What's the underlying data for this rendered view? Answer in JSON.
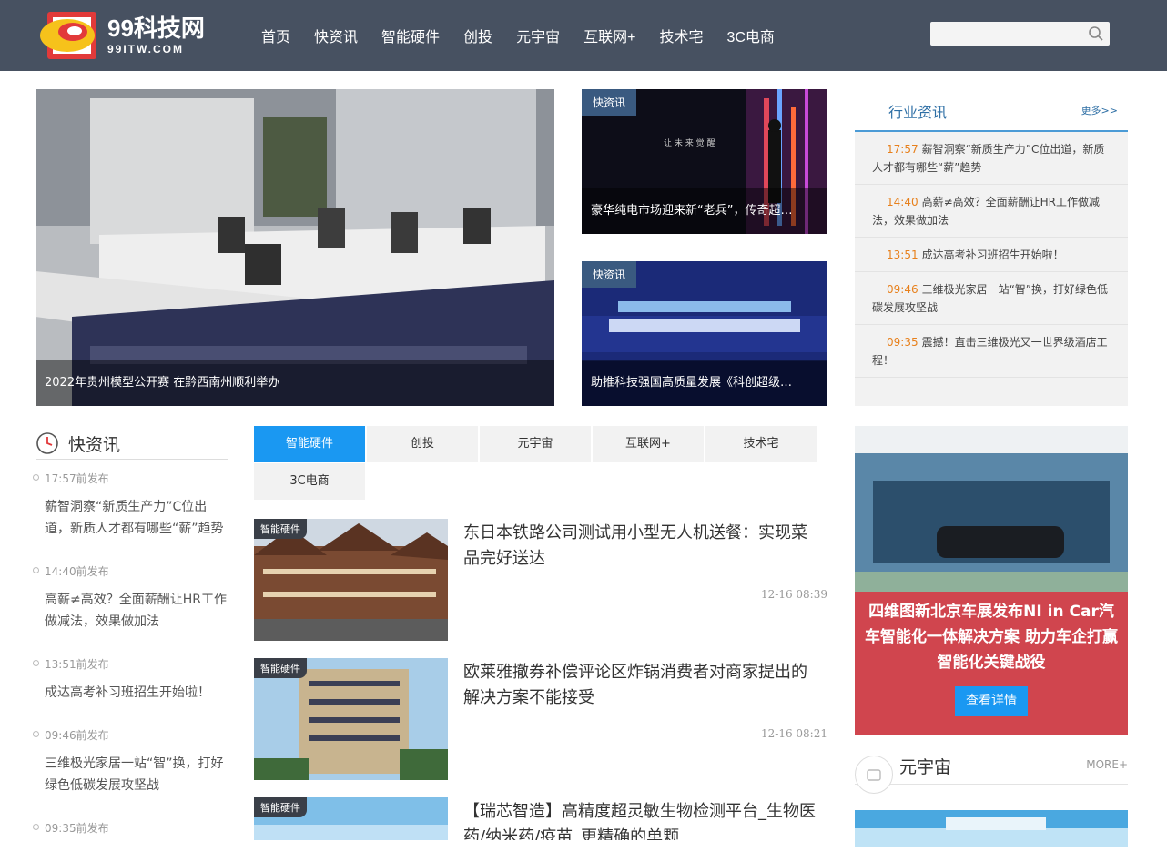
{
  "header": {
    "logo_text": "99科技网",
    "logo_sub": "99ITW.COM",
    "nav": [
      "首页",
      "快资讯",
      "智能硬件",
      "创投",
      "元宇宙",
      "互联网+",
      "技术宅",
      "3C电商"
    ],
    "search_placeholder": ""
  },
  "hero": {
    "caption": "2022年贵州模型公开赛 在黔西南州顺利举办"
  },
  "side_cards": [
    {
      "tag": "快资讯",
      "caption": "豪华纯电市场迎来新“老兵”，传奇超…"
    },
    {
      "tag": "快资讯",
      "caption": "助推科技强国高质量发展《科创超级…"
    }
  ],
  "industry": {
    "title": "行业资讯",
    "more": "更多>>",
    "items": [
      {
        "time": "17:57",
        "text": "薪智洞察“新质生产力”C位出道，新质人才都有哪些“薪”趋势"
      },
      {
        "time": "14:40",
        "text": "高薪≠高效？全面薪酬让HR工作做减法，效果做加法"
      },
      {
        "time": "13:51",
        "text": "成达高考补习班招生开始啦！"
      },
      {
        "time": "09:46",
        "text": "三维极光家居一站“智”换，打好绿色低碳发展攻坚战"
      },
      {
        "time": "09:35",
        "text": "震撼！直击三维极光又一世界级酒店工程！"
      }
    ]
  },
  "flash": {
    "title": "快资讯",
    "items": [
      {
        "time": "17:57前发布",
        "text": "薪智洞察“新质生产力”C位出道，新质人才都有哪些“薪”趋势"
      },
      {
        "time": "14:40前发布",
        "text": "高薪≠高效？全面薪酬让HR工作做减法，效果做加法"
      },
      {
        "time": "13:51前发布",
        "text": "成达高考补习班招生开始啦！"
      },
      {
        "time": "09:46前发布",
        "text": "三维极光家居一站“智”换，打好绿色低碳发展攻坚战"
      },
      {
        "time": "09:35前发布",
        "text": ""
      }
    ]
  },
  "tabs": [
    "智能硬件",
    "创投",
    "元宇宙",
    "互联网+",
    "技术宅",
    "3C电商"
  ],
  "articles": [
    {
      "tag": "智能硬件",
      "title": "东日本铁路公司测试用小型无人机送餐：实现菜品完好送达",
      "time": "12-16 08:39"
    },
    {
      "tag": "智能硬件",
      "title": "欧莱雅撤券补偿评论区炸锅消费者对商家提出的解决方案不能接受",
      "time": "12-16 08:21"
    },
    {
      "tag": "智能硬件",
      "title": "【瑞芯智造】高精度超灵敏生物检测平台_生物医药/纳米药/疫苗_更精确的单颗",
      "time": ""
    }
  ],
  "ad": {
    "title": "四维图新北京车展发布NI in Car汽车智能化一体解决方案 助力车企打赢智能化关键战役",
    "button": "查看详情"
  },
  "meta": {
    "title": "元宇宙",
    "more": "MORE+"
  }
}
